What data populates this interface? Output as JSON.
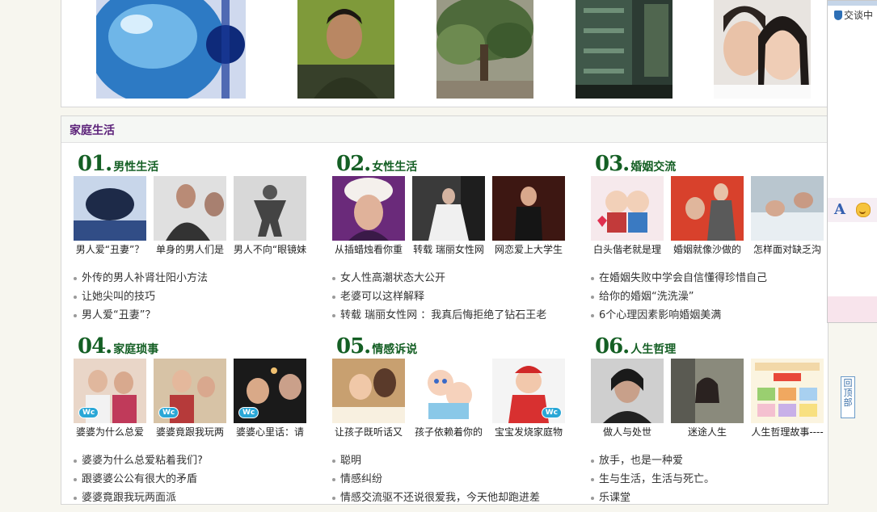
{
  "colors": {
    "section_title": "#5a1f78",
    "category_green": "#145f24",
    "page_bg": "#f7f6ef"
  },
  "top_photos": [
    {
      "icon": "blue-sphere-photo"
    },
    {
      "icon": "young-man-photo"
    },
    {
      "icon": "tree-photo"
    },
    {
      "icon": "building-photo"
    },
    {
      "icon": "couple-photo"
    }
  ],
  "section": {
    "title": "家庭生活"
  },
  "categories": [
    {
      "num": "01.",
      "title": "男性生活",
      "thumbs": [
        "男人爱“丑妻”？",
        "单身的男人们是",
        "男人不向“眼镜妹"
      ],
      "links": [
        "外传的男人补肾壮阳小方法",
        "让她尖叫的技巧",
        "男人爱“丑妻”？"
      ]
    },
    {
      "num": "02.",
      "title": "女性生活",
      "thumbs": [
        "从插蜡烛看你重",
        "转载 瑞丽女性网",
        "网恋爱上大学生"
      ],
      "links": [
        "女人性高潮状态大公开",
        "老婆可以这样解释",
        "转载 瑞丽女性网 ：我真后悔拒绝了钻石王老"
      ]
    },
    {
      "num": "03.",
      "title": "婚姻交流",
      "thumbs": [
        "白头偕老就是理",
        "婚姻就像沙做的",
        "怎样面对缺乏沟"
      ],
      "links": [
        "在婚姻失败中学会自信懂得珍惜自己",
        "给你的婚姻“洗洗澡”",
        "6个心理因素影响婚姻美满"
      ]
    },
    {
      "num": "04.",
      "title": "家庭琐事",
      "thumbs": [
        "婆婆为什么总爱",
        "婆婆竟跟我玩两",
        "婆婆心里话：请"
      ],
      "links": [
        "婆婆为什么总爱粘着我们?",
        "跟婆婆公公有很大的矛盾",
        "婆婆竟跟我玩两面派"
      ]
    },
    {
      "num": "05.",
      "title": "情感诉说",
      "thumbs": [
        "让孩子既听话又",
        "孩子依赖着你的",
        "宝宝发烧家庭物"
      ],
      "links": [
        "聪明",
        "情感纠纷",
        "情感交流驱不还说很爱我，今天他却跑进差"
      ]
    },
    {
      "num": "06.",
      "title": "人生哲理",
      "thumbs": [
        "做人与处世",
        "迷途人生",
        "人生哲理故事----"
      ],
      "links": [
        "放手，也是一种爱",
        "生与生活，生活与死亡。",
        "乐课堂"
      ]
    }
  ],
  "thumb_badge": "Wc",
  "chat": {
    "status": "交谈中"
  },
  "back_to_top": "回顶部"
}
